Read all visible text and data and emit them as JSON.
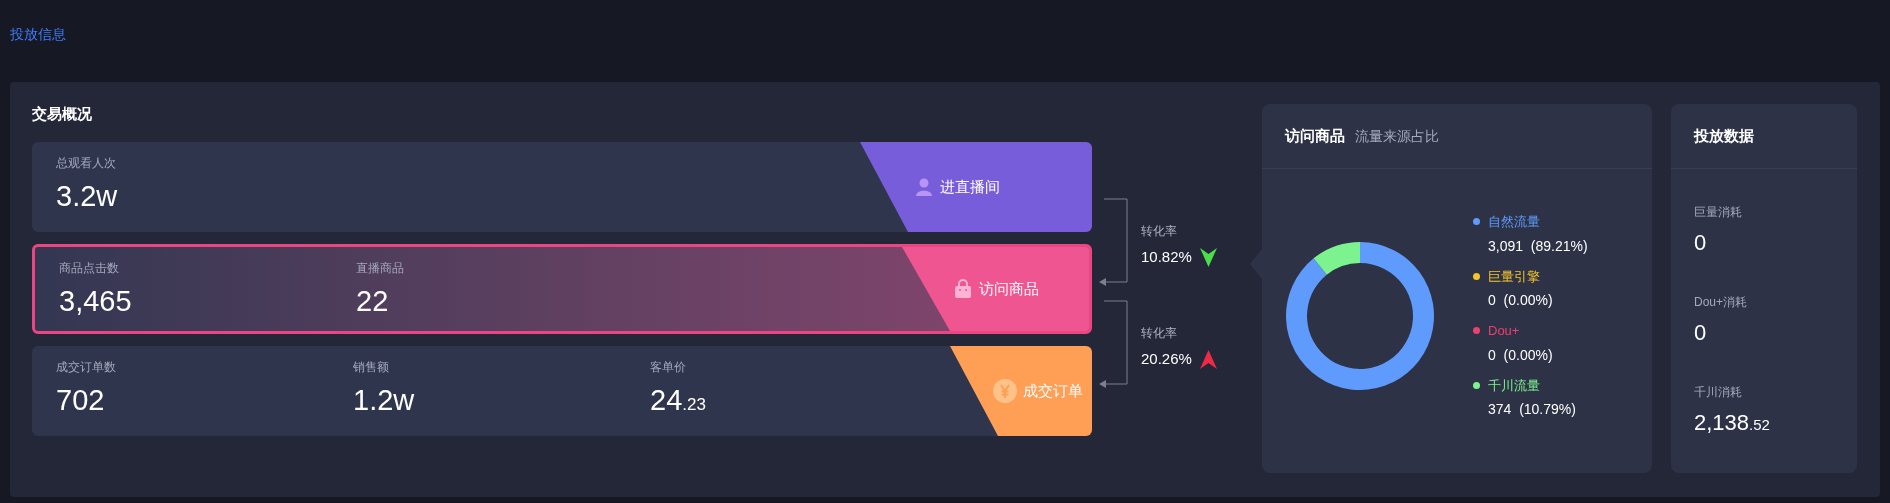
{
  "header_link": "投放信息",
  "overview": {
    "title": "交易概况",
    "rows": [
      {
        "highlighted": false,
        "metrics": [
          {
            "label": "总观看人次",
            "value": "3.2w"
          }
        ],
        "badge": {
          "label": "进直播间",
          "kind": "user",
          "color": "#785ddb"
        }
      },
      {
        "highlighted": true,
        "metrics": [
          {
            "label": "商品点击数",
            "value": "3,465"
          },
          {
            "label": "直播商品",
            "value": "22"
          }
        ],
        "badge": {
          "label": "访问商品",
          "kind": "bag",
          "color": "#ee5591"
        }
      },
      {
        "highlighted": false,
        "metrics": [
          {
            "label": "成交订单数",
            "value": "702"
          },
          {
            "label": "销售额",
            "value": "1.2w"
          },
          {
            "label": "客单价",
            "value": "24",
            "decimal": ".23"
          }
        ],
        "badge": {
          "label": "成交订单",
          "kind": "yen",
          "color": "#ff9f55"
        }
      }
    ],
    "conversions": [
      {
        "label": "转化率",
        "value": "10.82%",
        "kind": "down"
      },
      {
        "label": "转化率",
        "value": "20.26%",
        "kind": "up"
      }
    ]
  },
  "visits_card": {
    "title": "访问商品",
    "subtitle": "流量来源占比",
    "chart_data": {
      "type": "donut",
      "categories": [
        "自然流量",
        "巨量引擎",
        "Dou+",
        "千川流量"
      ],
      "values": [
        89.21,
        0,
        0,
        10.79
      ]
    },
    "legend": [
      {
        "reading": "3,091  (89.21%)",
        "color": "#5f9bfd"
      },
      {
        "reading": "0  (0.00%)",
        "color": "#f5c52b"
      },
      {
        "reading": "0  (0.00%)",
        "color": "#ef3f6e"
      },
      {
        "reading": "374  (10.79%)",
        "color": "#7cf38e"
      }
    ]
  },
  "ads_card": {
    "title": "投放数据",
    "items": [
      {
        "label": "巨量消耗",
        "value": "0"
      },
      {
        "label": "Dou+消耗",
        "value": "0"
      },
      {
        "label": "千川消耗",
        "value": "2,138",
        "decimal": ".52"
      }
    ]
  }
}
